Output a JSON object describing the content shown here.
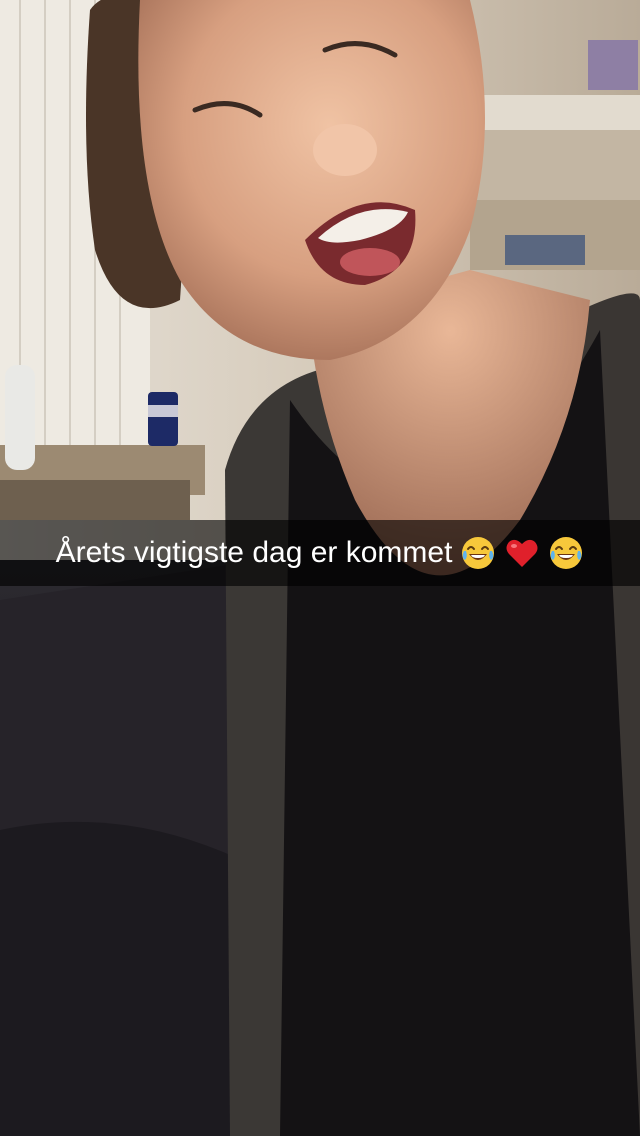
{
  "caption": {
    "text": "Årets vigtigste dag er kommet",
    "emojis": [
      "face-with-tears-of-joy-icon",
      "red-heart-icon",
      "face-with-tears-of-joy-icon"
    ]
  },
  "colors": {
    "caption_bar": "#000000",
    "caption_text": "#ffffff",
    "room_wall": "#d8cfc1",
    "sofa": "#232025",
    "shirt": "#141214",
    "cardigan": "#3a3734",
    "skin": "#d9a78a"
  }
}
